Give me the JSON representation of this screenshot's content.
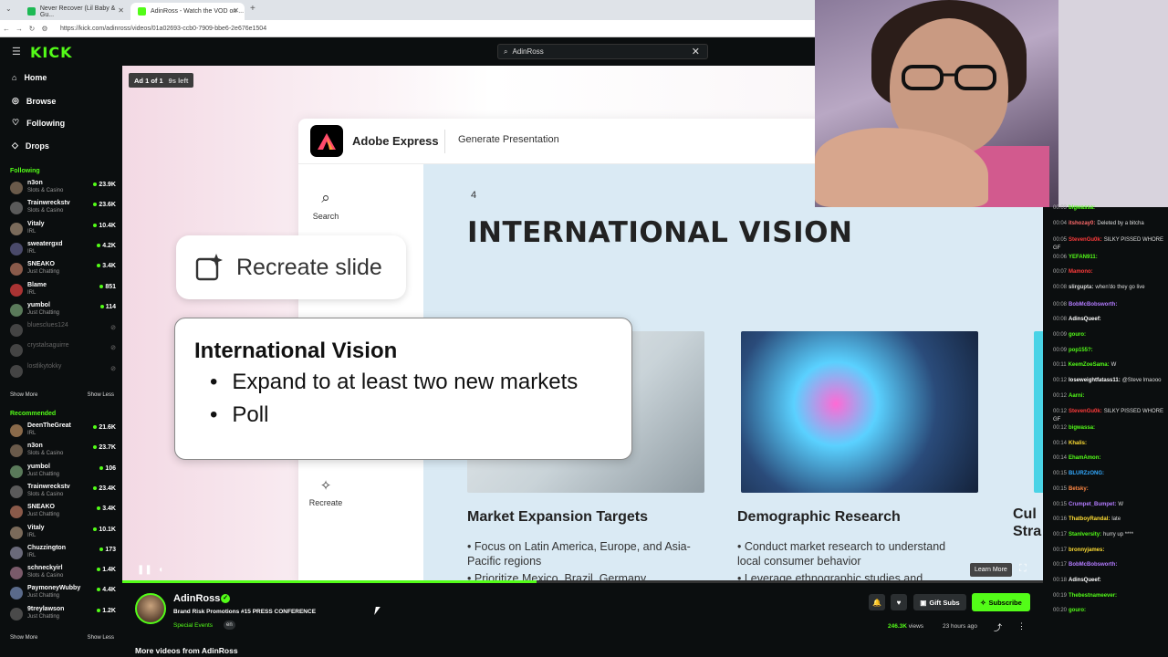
{
  "browser": {
    "tabs": [
      {
        "title": "Never Recover (Lil Baby & Gu..."
      },
      {
        "title": "AdinRoss - Watch the VOD on ..."
      }
    ],
    "url": "https://kick.com/adinross/videos/01a02693-ccb0-7909-bbe6-2e676e1504"
  },
  "kick": {
    "logo": "KICK",
    "search_value": "AdinRoss"
  },
  "sidebar": {
    "nav": [
      {
        "label": "Home",
        "icon": "home-icon"
      },
      {
        "label": "Browse",
        "icon": "compass-icon"
      },
      {
        "label": "Following",
        "icon": "heart-icon"
      },
      {
        "label": "Drops",
        "icon": "drop-icon"
      }
    ],
    "following_title": "Following",
    "following": [
      {
        "name": "n3on",
        "category": "Slots & Casino",
        "viewers": "23.9K",
        "color": "#6a5a4a"
      },
      {
        "name": "Trainwreckstv",
        "category": "Slots & Casino",
        "viewers": "23.6K",
        "color": "#5a5a5a"
      },
      {
        "name": "Vitaly",
        "category": "IRL",
        "viewers": "10.4K",
        "color": "#7a6a5a"
      },
      {
        "name": "sweatergxd",
        "category": "IRL",
        "viewers": "4.2K",
        "color": "#4a4a6a"
      },
      {
        "name": "SNEAKO",
        "category": "Just Chatting",
        "viewers": "3.4K",
        "color": "#8a5a4a"
      },
      {
        "name": "Blame",
        "category": "IRL",
        "viewers": "851",
        "color": "#aa3333"
      },
      {
        "name": "yumbol",
        "category": "Just Chatting",
        "viewers": "114",
        "color": "#5a7a5a"
      },
      {
        "name": "bluesclues124",
        "category": "",
        "viewers": "",
        "color": "#444",
        "offline": true
      },
      {
        "name": "crystalsaguirre",
        "category": "",
        "viewers": "",
        "color": "#444",
        "offline": true
      },
      {
        "name": "lostlikytokky",
        "category": "",
        "viewers": "",
        "color": "#444",
        "offline": true
      }
    ],
    "show_more": "Show More",
    "show_less": "Show Less",
    "recommended_title": "Recommended",
    "recommended": [
      {
        "name": "DeenTheGreat",
        "category": "IRL",
        "viewers": "21.6K",
        "color": "#8a6a4a"
      },
      {
        "name": "n3on",
        "category": "Slots & Casino",
        "viewers": "23.7K",
        "color": "#6a5a4a"
      },
      {
        "name": "yumbol",
        "category": "Just Chatting",
        "viewers": "106",
        "color": "#5a7a5a"
      },
      {
        "name": "Trainwreckstv",
        "category": "Slots & Casino",
        "viewers": "23.4K",
        "color": "#5a5a5a"
      },
      {
        "name": "SNEAKO",
        "category": "Just Chatting",
        "viewers": "3.4K",
        "color": "#8a5a4a"
      },
      {
        "name": "Vitaly",
        "category": "IRL",
        "viewers": "10.1K",
        "color": "#7a6a5a"
      },
      {
        "name": "Chuzzington",
        "category": "IRL",
        "viewers": "173",
        "color": "#6a6a7a"
      },
      {
        "name": "schneckyirl",
        "category": "Slots & Casino",
        "viewers": "1.4K",
        "color": "#7a5a6a"
      },
      {
        "name": "PaymoneyWubby",
        "category": "Just Chatting",
        "viewers": "4.4K",
        "color": "#5a6a8a"
      },
      {
        "name": "9treylawson",
        "category": "Just Chatting",
        "viewers": "1.2K",
        "color": "#4a4a4a"
      }
    ]
  },
  "ad": {
    "label": "Ad 1 of 1",
    "time_left": "9s left",
    "learn_more": "Learn More",
    "progress": 0.45,
    "adobe": {
      "app_name": "Adobe Express",
      "tool": "Generate Presentation",
      "rail_search": "Search",
      "rail_recreate": "Recreate",
      "slide_number": "4",
      "slide_title": "INTERNATIONAL VISION",
      "cards": [
        {
          "heading": "Market Expansion Targets",
          "bullets": [
            "Focus on Latin America, Europe, and Asia-Pacific regions",
            "Prioritize Mexico, Brazil, Germany"
          ]
        },
        {
          "heading": "Demographic Research",
          "bullets": [
            "Conduct market research to understand local consumer behavior",
            "Leverage ethnographic studies and"
          ]
        },
        {
          "heading": "Cul Stra",
          "bullets": []
        }
      ],
      "recreate_button": "Recreate slide",
      "popup_title": "International Vision",
      "popup_items": [
        "Expand to at least two new markets",
        "Poll"
      ]
    }
  },
  "chat": [
    {
      "t": "00:03",
      "u": "bigwassa:",
      "m": "",
      "c": "#53fc18"
    },
    {
      "t": "00:04",
      "u": "itshozay0:",
      "m": "Deleted by a bitcha",
      "c": "#ff6b6b"
    },
    {
      "t": "00:05",
      "u": "StevenGu0k:",
      "m": "SILKY PISSED WHORE GF",
      "c": "#ff3b3b"
    },
    {
      "t": "00:06",
      "u": "YEFAN911:",
      "m": "",
      "c": "#53fc18"
    },
    {
      "t": "00:07",
      "u": "Mamono:",
      "m": "",
      "c": "#ff3b3b"
    },
    {
      "t": "00:08",
      "u": "slirgupta:",
      "m": "when'do they go live",
      "c": "#dddddd"
    },
    {
      "t": "00:08",
      "u": "BobMcBobsworth:",
      "m": "",
      "c": "#b37bff"
    },
    {
      "t": "00:08",
      "u": "AdinsQueef:",
      "m": "",
      "c": "#ffffff"
    },
    {
      "t": "00:09",
      "u": "gouro:",
      "m": "",
      "c": "#53fc18"
    },
    {
      "t": "00:09",
      "u": "pop155?:",
      "m": "",
      "c": "#53fc18"
    },
    {
      "t": "00:11",
      "u": "KeemZoeSama:",
      "m": "W",
      "c": "#53fc18"
    },
    {
      "t": "00:12",
      "u": "loseweightfatass11:",
      "m": "@Steve lmaooo",
      "c": "#ffffff"
    },
    {
      "t": "00:12",
      "u": "Aarni:",
      "m": "",
      "c": "#53fc18"
    },
    {
      "t": "00:12",
      "u": "StevenGu0k:",
      "m": "SILKY PISSED WHORE GF",
      "c": "#ff3b3b"
    },
    {
      "t": "00:12",
      "u": "bigwassa:",
      "m": "",
      "c": "#53fc18"
    },
    {
      "t": "00:14",
      "u": "Khalis:",
      "m": "",
      "c": "#ffdd33"
    },
    {
      "t": "00:14",
      "u": "EhamAmon:",
      "m": "",
      "c": "#53fc18"
    },
    {
      "t": "00:15",
      "u": "BLURZzONG:",
      "m": "",
      "c": "#33aaff"
    },
    {
      "t": "00:15",
      "u": "Betsky:",
      "m": "",
      "c": "#ff8844"
    },
    {
      "t": "00:15",
      "u": "Crumpet_Bumpet:",
      "m": "W",
      "c": "#b37bff"
    },
    {
      "t": "00:16",
      "u": "ThatboyRandal:",
      "m": "late",
      "c": "#ffdd33"
    },
    {
      "t": "00:17",
      "u": "Stanlversity:",
      "m": "hurry up ****",
      "c": "#53fc18"
    },
    {
      "t": "00:17",
      "u": "bronnyjames:",
      "m": "",
      "c": "#ffdd33"
    },
    {
      "t": "00:17",
      "u": "BobMcBobsworth:",
      "m": "",
      "c": "#b37bff"
    },
    {
      "t": "00:18",
      "u": "AdinsQueef:",
      "m": "",
      "c": "#ffffff"
    },
    {
      "t": "00:19",
      "u": "Thebestnameever:",
      "m": "",
      "c": "#53fc18"
    },
    {
      "t": "00:20",
      "u": "gouro:",
      "m": "",
      "c": "#53fc18"
    }
  ],
  "stream": {
    "name": "AdinRoss",
    "title": "Brand Risk Promotions #15 PRESS CONFERENCE",
    "category": "Special Events",
    "language": "en",
    "gift_subs": "Gift Subs",
    "subscribe": "Subscribe",
    "views": "246.3K",
    "views_label": "views",
    "ago": "23 hours ago",
    "more_videos": "More videos from AdinRoss"
  },
  "colors": {
    "accent": "#53fc18",
    "bg": "#0b0e0f"
  }
}
